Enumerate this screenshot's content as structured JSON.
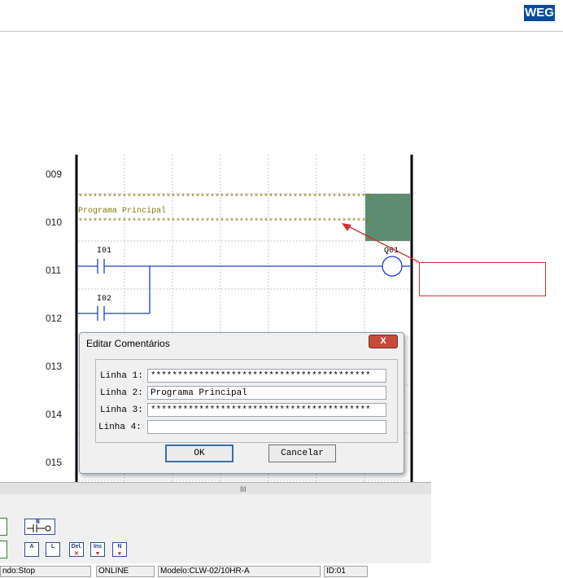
{
  "header": {
    "logo_text": "WEG"
  },
  "ladder": {
    "rows": [
      "009",
      "010",
      "011",
      "012",
      "013",
      "014",
      "015"
    ],
    "comment_stars": "************************************************************",
    "comment_text": "Programa Principal",
    "contact_1": "I01",
    "contact_2": "I02",
    "coil": "Q01"
  },
  "dialog": {
    "title": "Editar Comentários",
    "close_label": "X",
    "lines": [
      {
        "label": "Linha 1:",
        "value": "*****************************************"
      },
      {
        "label": "Linha 2:",
        "value": "Programa Principal"
      },
      {
        "label": "Linha 3:",
        "value": "*****************************************"
      },
      {
        "label": "Linha 4:",
        "value": ""
      }
    ],
    "ok_label": "OK",
    "cancel_label": "Cancelar"
  },
  "splitter": {
    "grip": "III"
  },
  "toolbar": {
    "row1": {
      "coil_btn": "N"
    },
    "row2": {
      "btn_a": "A",
      "btn_l": "L",
      "del": "Del.",
      "ins": "Ins",
      "btn_n": "N"
    }
  },
  "statusbar": {
    "mode": "ndo:Stop",
    "online": "ONLINE",
    "model": "Modelo:CLW-02/10HR-A",
    "id": "ID:01"
  },
  "colors": {
    "ladder_blue": "#1e3fc8",
    "comment_gold": "#8a7a10",
    "selected_cell": "#5e8c70",
    "callout_red": "#d03030"
  }
}
